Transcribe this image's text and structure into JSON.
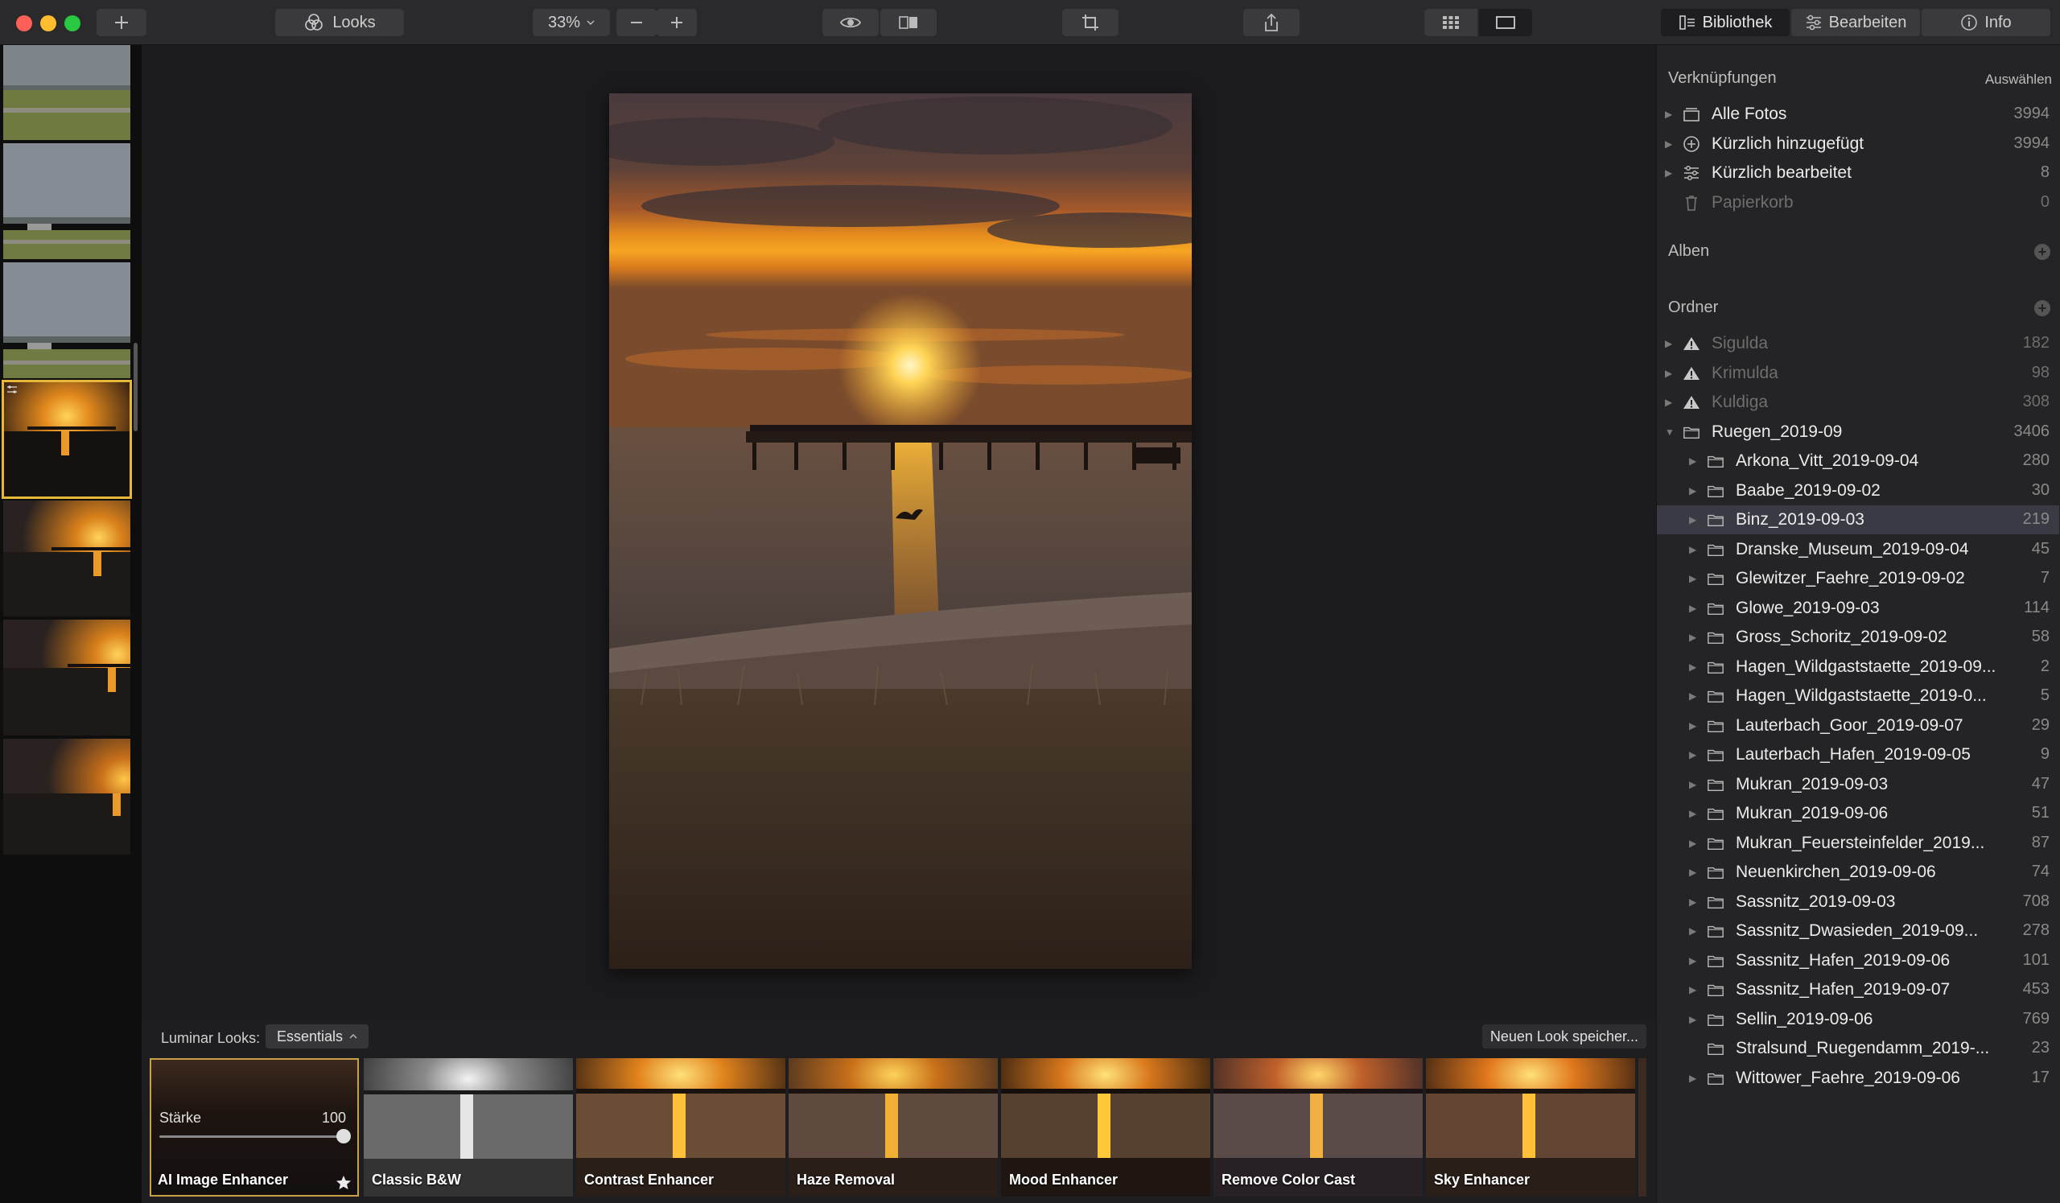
{
  "toolbar": {
    "looks_label": "Looks",
    "zoom_value": "33%",
    "tabs": [
      {
        "label": "Bibliothek",
        "icon": "library-icon",
        "active": true
      },
      {
        "label": "Bearbeiten",
        "icon": "sliders-icon",
        "active": false
      },
      {
        "label": "Info",
        "icon": "info-icon",
        "active": false
      }
    ]
  },
  "colors": {
    "close": "#fe5f57",
    "minimize": "#febc2e",
    "maximize": "#28c840",
    "selection_outline": "#e7b73a",
    "selected_row": "#3a3a45"
  },
  "looks_panel": {
    "label": "Luminar Looks:",
    "category": "Essentials",
    "save_label": "Neuen Look speicher...",
    "strength_label": "Stärke",
    "strength_value": "100",
    "looks": [
      {
        "name": "AI Image Enhancer",
        "active": true,
        "favorite": true
      },
      {
        "name": "Classic B&W"
      },
      {
        "name": "Contrast Enhancer"
      },
      {
        "name": "Haze Removal"
      },
      {
        "name": "Mood Enhancer"
      },
      {
        "name": "Remove Color Cast"
      },
      {
        "name": "Sky Enhancer"
      }
    ]
  },
  "sidebar": {
    "shortcuts_title": "Verknüpfungen",
    "shortcuts_action": "Auswählen",
    "shortcuts": [
      {
        "name": "Alle Fotos",
        "count": "3994",
        "icon": "photos-stack-icon"
      },
      {
        "name": "Kürzlich hinzugefügt",
        "count": "3994",
        "icon": "plus-circle-icon"
      },
      {
        "name": "Kürzlich bearbeitet",
        "count": "8",
        "icon": "sliders-icon"
      },
      {
        "name": "Papierkorb",
        "count": "0",
        "icon": "trash-icon",
        "dim": true
      }
    ],
    "albums_title": "Alben",
    "folders_title": "Ordner",
    "folders": [
      {
        "name": "Sigulda",
        "count": "182",
        "level": 0,
        "warn": true
      },
      {
        "name": "Krimulda",
        "count": "98",
        "level": 0,
        "warn": true
      },
      {
        "name": "Kuldiga",
        "count": "308",
        "level": 0,
        "warn": true
      },
      {
        "name": "Ruegen_2019-09",
        "count": "3406",
        "level": 0,
        "expanded": true
      },
      {
        "name": "Arkona_Vitt_2019-09-04",
        "count": "280",
        "level": 1
      },
      {
        "name": "Baabe_2019-09-02",
        "count": "30",
        "level": 1
      },
      {
        "name": "Binz_2019-09-03",
        "count": "219",
        "level": 1,
        "selected": true
      },
      {
        "name": "Dranske_Museum_2019-09-04",
        "count": "45",
        "level": 1
      },
      {
        "name": "Glewitzer_Faehre_2019-09-02",
        "count": "7",
        "level": 1
      },
      {
        "name": "Glowe_2019-09-03",
        "count": "114",
        "level": 1
      },
      {
        "name": "Gross_Schoritz_2019-09-02",
        "count": "58",
        "level": 1
      },
      {
        "name": "Hagen_Wildgaststaette_2019-09...",
        "count": "2",
        "level": 1
      },
      {
        "name": "Hagen_Wildgaststaette_2019-0...",
        "count": "5",
        "level": 1
      },
      {
        "name": "Lauterbach_Goor_2019-09-07",
        "count": "29",
        "level": 1
      },
      {
        "name": "Lauterbach_Hafen_2019-09-05",
        "count": "9",
        "level": 1
      },
      {
        "name": "Mukran_2019-09-03",
        "count": "47",
        "level": 1
      },
      {
        "name": "Mukran_2019-09-06",
        "count": "51",
        "level": 1
      },
      {
        "name": "Mukran_Feuersteinfelder_2019...",
        "count": "87",
        "level": 1
      },
      {
        "name": "Neuenkirchen_2019-09-06",
        "count": "74",
        "level": 1
      },
      {
        "name": "Sassnitz_2019-09-03",
        "count": "708",
        "level": 1
      },
      {
        "name": "Sassnitz_Dwasieden_2019-09...",
        "count": "278",
        "level": 1
      },
      {
        "name": "Sassnitz_Hafen_2019-09-06",
        "count": "101",
        "level": 1
      },
      {
        "name": "Sassnitz_Hafen_2019-09-07",
        "count": "453",
        "level": 1
      },
      {
        "name": "Sellin_2019-09-06",
        "count": "769",
        "level": 1
      },
      {
        "name": "Stralsund_Ruegendamm_2019-...",
        "count": "23",
        "level": 1,
        "no_arrow": true
      },
      {
        "name": "Wittower_Faehre_2019-09-06",
        "count": "17",
        "level": 1
      }
    ]
  }
}
